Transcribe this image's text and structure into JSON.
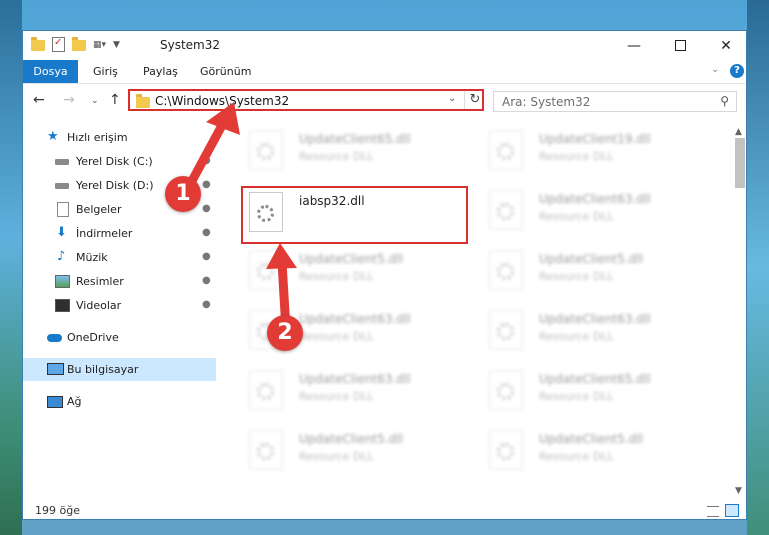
{
  "window": {
    "title": "System32"
  },
  "ribbon": {
    "tabs": [
      "Dosya",
      "Giriş",
      "Paylaş",
      "Görünüm"
    ]
  },
  "address": {
    "path": "C:\\Windows\\System32",
    "search_placeholder": "Ara: System32"
  },
  "sidebar": {
    "items": [
      {
        "label": "Hızlı erişim",
        "icon": "star-icon"
      },
      {
        "label": "Yerel Disk (C:)",
        "icon": "drive-icon",
        "pinned": true
      },
      {
        "label": "Yerel Disk (D:)",
        "icon": "drive-icon",
        "pinned": true
      },
      {
        "label": "Belgeler",
        "icon": "documents-icon",
        "pinned": true
      },
      {
        "label": "İndirmeler",
        "icon": "download-icon",
        "pinned": true
      },
      {
        "label": "Müzik",
        "icon": "music-icon",
        "pinned": true
      },
      {
        "label": "Resimler",
        "icon": "pictures-icon",
        "pinned": true
      },
      {
        "label": "Videolar",
        "icon": "videos-icon",
        "pinned": true
      },
      {
        "label": "OneDrive",
        "icon": "onedrive-icon"
      },
      {
        "label": "Bu bilgisayar",
        "icon": "this-pc-icon",
        "selected": true
      },
      {
        "label": "Ağ",
        "icon": "network-icon"
      }
    ]
  },
  "files": [
    {
      "name": "UpdateClient65.dll",
      "type": "Resource DLL"
    },
    {
      "name": "UpdateClient19.dll",
      "type": "Resource DLL"
    },
    {
      "name": "iabsp32.dll",
      "type": ""
    },
    {
      "name": "UpdateClient63.dll",
      "type": "Resource DLL"
    },
    {
      "name": "UpdateClient5.dll",
      "type": "Resource DLL"
    },
    {
      "name": "UpdateClient5.dll",
      "type": "Resource DLL"
    },
    {
      "name": "UpdateClient63.dll",
      "type": "Resource DLL"
    },
    {
      "name": "UpdateClient63.dll",
      "type": "Resource DLL"
    },
    {
      "name": "UpdateClient63.dll",
      "type": "Resource DLL"
    },
    {
      "name": "UpdateClient65.dll",
      "type": "Resource DLL"
    },
    {
      "name": "UpdateClient5.dll",
      "type": "Resource DLL"
    },
    {
      "name": "UpdateClient5.dll",
      "type": "Resource DLL"
    }
  ],
  "status": {
    "count": "199 öğe"
  },
  "annotations": {
    "step1": "1",
    "step2": "2"
  },
  "colors": {
    "accent": "#1979ca",
    "highlight": "#d9302b",
    "selected_bg": "#cce8ff"
  }
}
